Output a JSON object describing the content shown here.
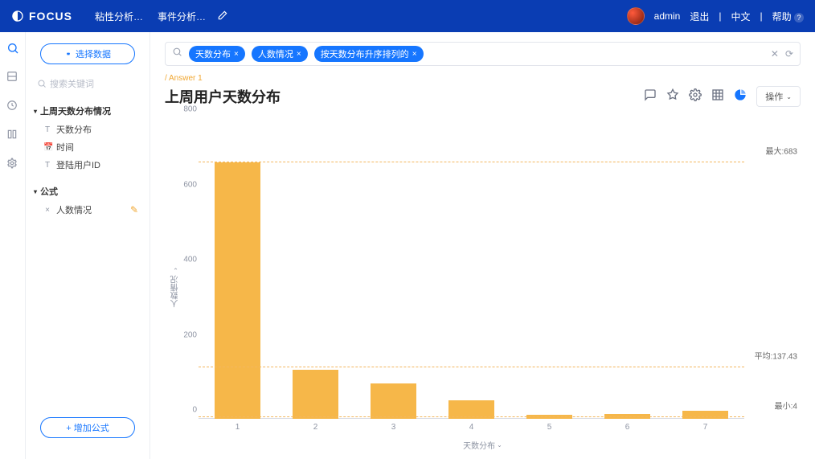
{
  "brand": "FOCUS",
  "nav": {
    "items": [
      "粘性分析…",
      "事件分析…"
    ]
  },
  "user": {
    "name": "admin",
    "logout": "退出",
    "lang": "中文",
    "help": "帮助"
  },
  "sidebar": {
    "select_ds": "选择数据",
    "search_placeholder": "搜索关键词",
    "section1": "上周天数分布情况",
    "items1": [
      "天数分布",
      "时间",
      "登陆用户ID"
    ],
    "section2": "公式",
    "formula_item": "人数情况",
    "add_formula": "+ 增加公式"
  },
  "query": {
    "chips": [
      "天数分布",
      "人数情况",
      "按天数分布升序排列的"
    ]
  },
  "breadcrumb": "/ Answer 1",
  "title": "上周用户天数分布",
  "ops_label": "操作",
  "chart_data": {
    "type": "bar",
    "title": "上周用户天数分布",
    "xlabel": "天数分布",
    "ylabel": "人数情况",
    "categories": [
      "1",
      "2",
      "3",
      "4",
      "5",
      "6",
      "7"
    ],
    "values": [
      683,
      130,
      95,
      50,
      10,
      12,
      22
    ],
    "ylim": [
      0,
      800
    ],
    "yticks": [
      0,
      200,
      400,
      600,
      800
    ],
    "reference_lines": [
      {
        "label": "最大:683",
        "value": 683
      },
      {
        "label": "平均:137.43",
        "value": 137.43
      },
      {
        "label": "最小:4",
        "value": 4
      }
    ]
  }
}
